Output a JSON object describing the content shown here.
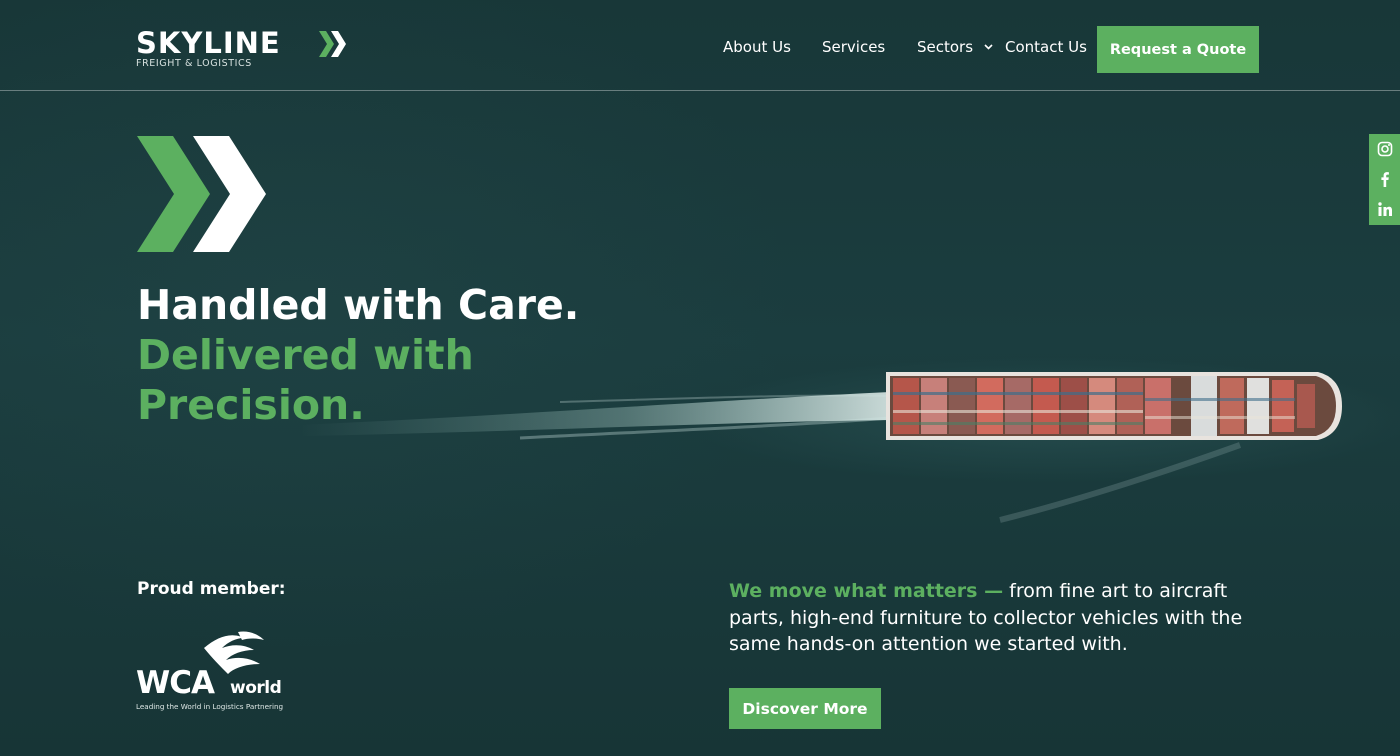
{
  "brand": {
    "name": "SKYLINE",
    "tagline": "FREIGHT & LOGISTICS"
  },
  "nav": {
    "items": [
      {
        "label": "About Us"
      },
      {
        "label": "Services"
      },
      {
        "label": "Sectors"
      },
      {
        "label": "Contact Us"
      }
    ],
    "cta_label": "Request a Quote"
  },
  "social": {
    "items": [
      {
        "icon": "instagram-icon"
      },
      {
        "icon": "facebook-icon"
      },
      {
        "icon": "linkedin-icon"
      }
    ]
  },
  "hero": {
    "headline_line1": "Handled with Care.",
    "headline_line2": "Delivered with Precision.",
    "blurb_accent": "We move what matters —",
    "blurb_rest": "from fine art to aircraft parts, high-end furniture to collector vehicles  with the same hands-on attention we started with.",
    "button_label": "Discover More"
  },
  "membership": {
    "label": "Proud member:",
    "logo_word": "WCA",
    "logo_suffix": "world",
    "logo_tagline": "Leading the World in Logistics Partnering"
  },
  "colors": {
    "accent": "#5cb060",
    "background": "#1a3a3c",
    "text": "#ffffff"
  }
}
